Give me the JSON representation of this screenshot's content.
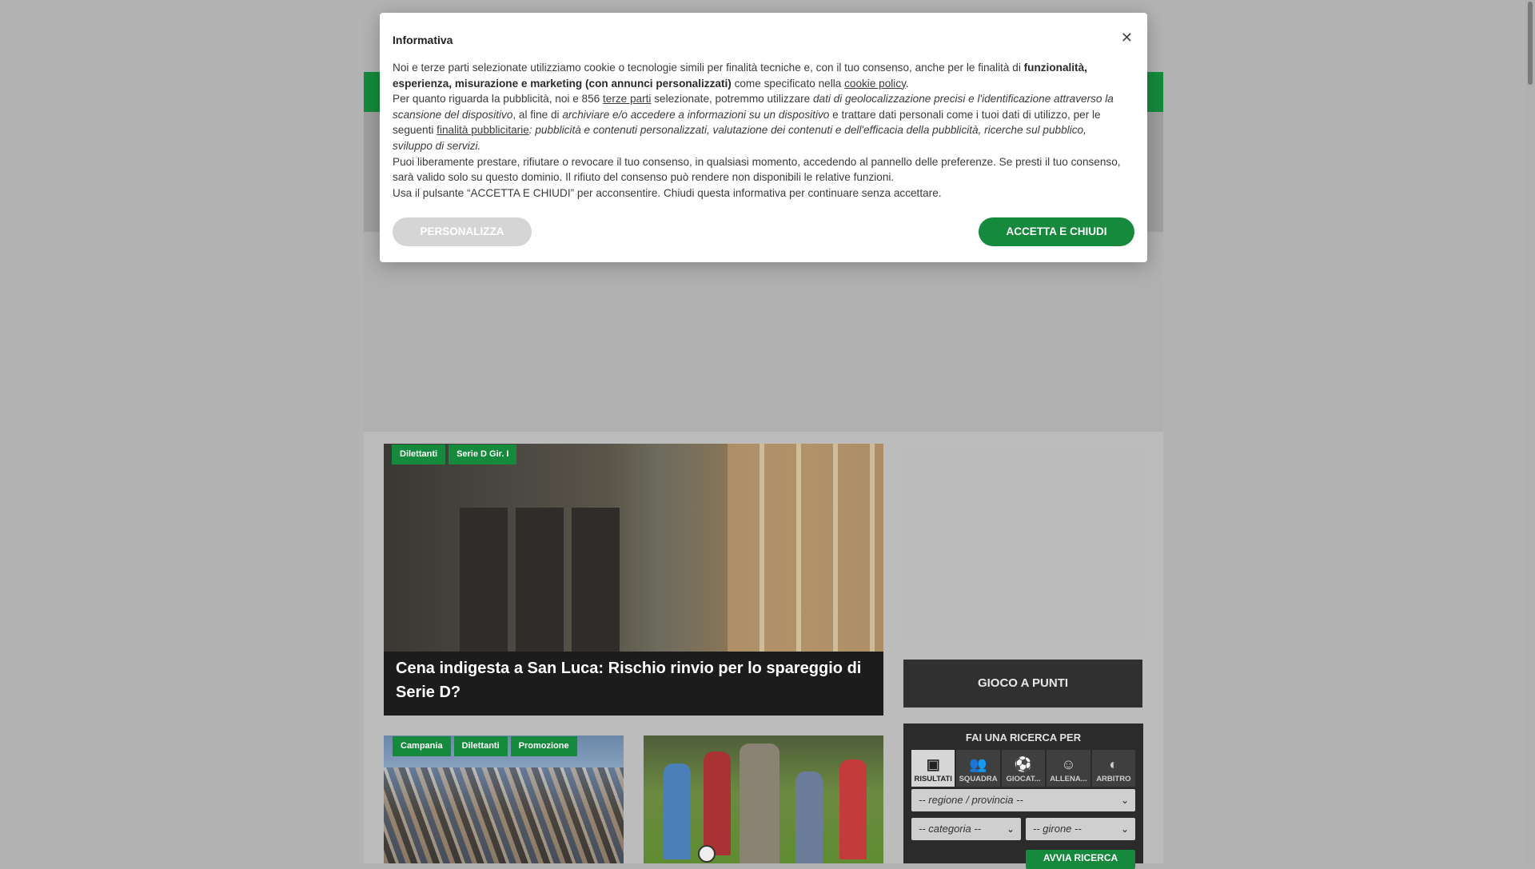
{
  "colors": {
    "brand_green": "#158a3c",
    "overlay": "#b3b3b3",
    "dark": "#2b2b2b"
  },
  "consent": {
    "title": "Informativa",
    "close_icon": "close-icon",
    "p1_a": "Noi e terze parti selezionate utilizziamo cookie o tecnologie simili per finalità tecniche e, con il tuo consenso, anche per le finalità di ",
    "p1_b": "funzionalità, esperienza, misurazione e marketing (con annunci personalizzati)",
    "p1_c": " come specificato nella ",
    "p1_link": "cookie policy",
    "p1_d": ".",
    "p2_a": "Per quanto riguarda la pubblicità, noi e 856 ",
    "p2_link1": "terze parti",
    "p2_b": " selezionate, potremmo utilizzare ",
    "p2_c": "dati di geolocalizzazione precisi e l'identificazione attraverso la scansione del dispositivo",
    "p2_d": ", al fine di ",
    "p2_e": "archiviare e/o accedere a informazioni su un dispositivo",
    "p2_f": " e trattare dati personali come i tuoi dati di utilizzo, per le seguenti ",
    "p2_link2": "finalità pubblicitarie",
    "p2_g": ": pubblicità e contenuti personalizzati, valutazione dei contenuti e dell'efficacia della pubblicità, ricerche sul pubblico, sviluppo di servizi.",
    "p3": "Puoi liberamente prestare, rifiutare o revocare il tuo consenso, in qualsiasi momento, accedendo al pannello delle preferenze. Se presti il tuo consenso, sarà valido solo su questo dominio. Il rifiuto del consenso può rendere non disponibili le relative funzioni.",
    "p4": "Usa il pulsante “ACCETTA E CHIUDI” per acconsentire. Chiudi questa informativa per continuare senza accettare.",
    "btn_personalizza": "PERSONALIZZA",
    "btn_accetta": "ACCETTA E CHIUDI"
  },
  "hero": {
    "tags": [
      "Dilettanti",
      "Serie D Gir. I"
    ],
    "title": "Cena indigesta a San Luca: Rischio rinvio per lo spareggio di Serie D?"
  },
  "card1": {
    "tags": [
      "Campania",
      "Dilettanti",
      "Promozione"
    ]
  },
  "sidebar": {
    "gioco_label": "GIOCO A PUNTI",
    "search": {
      "title": "FAI UNA RICERCA PER",
      "tabs": [
        {
          "label": "RISULTATI",
          "icon": "field-icon"
        },
        {
          "label": "SQUADRA",
          "icon": "team-icon"
        },
        {
          "label": "GIOCAT...",
          "icon": "player-icon"
        },
        {
          "label": "ALLENA...",
          "icon": "coach-icon"
        },
        {
          "label": "ARBITRO",
          "icon": "whistle-icon"
        }
      ],
      "regione": "-- regione / provincia --",
      "categoria": "-- categoria --",
      "girone": "-- girone --",
      "submit": "AVVIA RICERCA"
    }
  }
}
